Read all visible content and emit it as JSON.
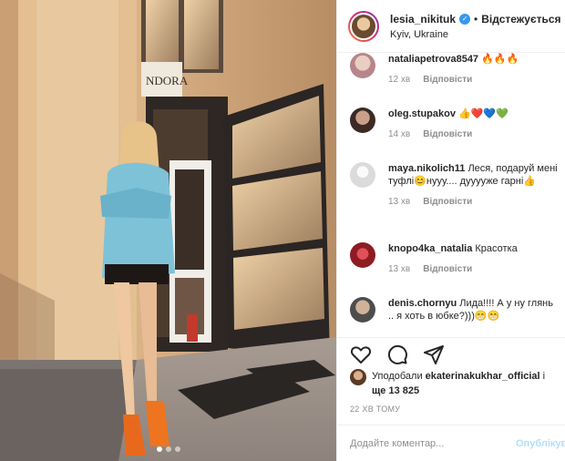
{
  "header": {
    "username": "lesia_nikituk",
    "separator": "•",
    "follow_state": "Відстежується",
    "location": "Kyiv, Ukraine"
  },
  "photo": {
    "sign_text": "NDORA",
    "carousel_slides": 3,
    "carousel_active": 1
  },
  "comments": [
    {
      "user": "nataliapetrova8547",
      "text": "🔥🔥🔥",
      "time": "12 хв",
      "reply": "Відповісти",
      "avatar_color": "#d8b4a6"
    },
    {
      "user": "oleg.stupakov",
      "text": "👍❤️💙💚",
      "time": "14 хв",
      "reply": "Відповісти",
      "avatar_color": "#5a3f35"
    },
    {
      "user": "maya.nikolich11",
      "text": "Леся, подаруй мені туфлі😊нууу.... дуууужe гарні👍",
      "time": "13 хв",
      "reply": "Відповісти",
      "avatar_color": "#dbdbdb"
    },
    {
      "user": "knopo4ka_natalia",
      "text": "Красотка",
      "time": "13 хв",
      "reply": "Відповісти",
      "avatar_color": "#b0242c"
    },
    {
      "user": "denis.chornyu",
      "text": "Лида!!!! А у ну глянь .. я хоть в юбке?)))😁😁",
      "time": "",
      "reply": "",
      "avatar_color": "#8a8a8a"
    }
  ],
  "likes": {
    "prefix": "Уподобали",
    "user": "ekaterinakukhar_official",
    "connector": "і",
    "more": "ще 13 825"
  },
  "timestamp": "22 ХВ ТОМУ",
  "add_comment": {
    "placeholder": "Додайте коментар...",
    "publish_label": "Опублікувати"
  },
  "icons": [
    "heart-icon",
    "comment-icon",
    "share-icon"
  ]
}
